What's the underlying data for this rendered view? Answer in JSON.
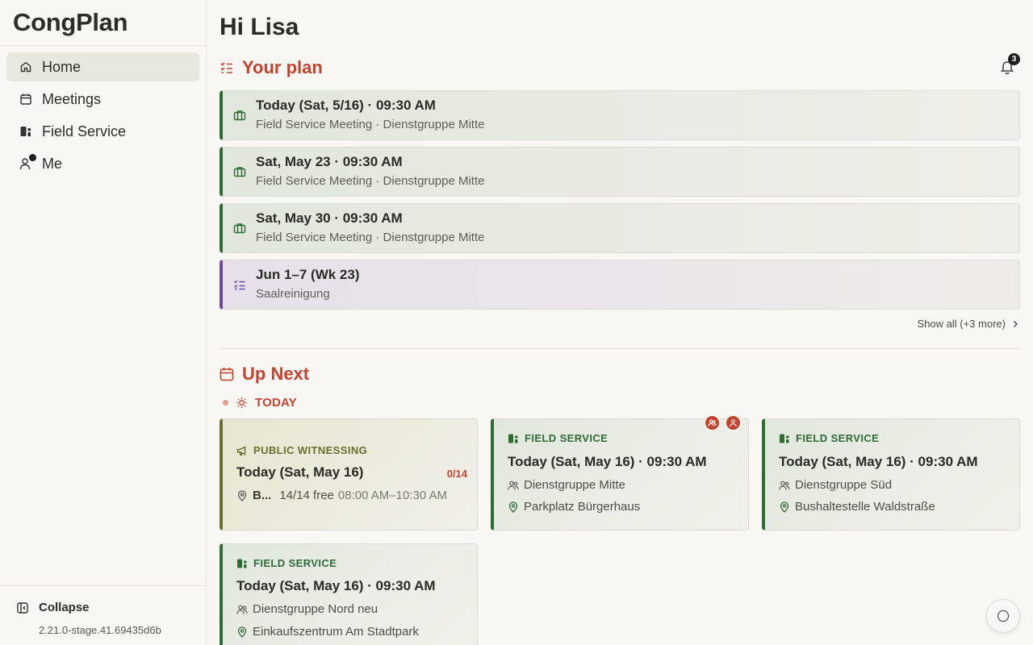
{
  "app": {
    "name": "CongPlan",
    "version": "2.21.0-stage.41.69435d6b"
  },
  "sidebar": {
    "items": [
      {
        "label": "Home",
        "icon": "home-icon",
        "active": true
      },
      {
        "label": "Meetings",
        "icon": "calendar-icon"
      },
      {
        "label": "Field Service",
        "icon": "field-service-icon"
      },
      {
        "label": "Me",
        "icon": "user-icon",
        "has_dot": true
      }
    ],
    "collapse_label": "Collapse"
  },
  "greeting": "Hi Lisa",
  "notifications": {
    "count": "3"
  },
  "plan": {
    "title": "Your plan",
    "items": [
      {
        "title": "Today (Sat, 5/16) · 09:30 AM",
        "subtitle": "Field Service Meeting · Dienstgruppe Mitte",
        "icon": "briefcase-icon",
        "color": "#2e6b35"
      },
      {
        "title": "Sat, May 23 · 09:30 AM",
        "subtitle": "Field Service Meeting · Dienstgruppe Mitte",
        "icon": "briefcase-icon",
        "color": "#2e6b35"
      },
      {
        "title": "Sat, May 30 · 09:30 AM",
        "subtitle": "Field Service Meeting · Dienstgruppe Mitte",
        "icon": "briefcase-icon",
        "color": "#2e6b35"
      },
      {
        "title": "Jun 1–7 (Wk 23)",
        "subtitle": "Saalreinigung",
        "icon": "checklist-icon",
        "color": "#6d4a9c"
      }
    ],
    "show_all": "Show all (+3 more)"
  },
  "up_next": {
    "title": "Up Next",
    "today_label": "TODAY",
    "cards": [
      {
        "kind": "PUBLIC WITNESSING",
        "title": "Today (Sat, May 16)",
        "count": "0/14",
        "location_short": "B...",
        "free": "14/14 free",
        "time": "08:00 AM–10:30 AM"
      },
      {
        "kind": "FIELD SERVICE",
        "title": "Today (Sat, May 16) · 09:30 AM",
        "group": "Dienstgruppe Mitte",
        "location": "Parkplatz Bürgerhaus"
      },
      {
        "kind": "FIELD SERVICE",
        "title": "Today (Sat, May 16) · 09:30 AM",
        "group": "Dienstgruppe Süd",
        "location": "Bushaltestelle Waldstraße"
      },
      {
        "kind": "FIELD SERVICE",
        "title": "Today (Sat, May 16) · 09:30 AM",
        "group": "Dienstgruppe Nord neu",
        "location": "Einkaufszentrum Am Stadtpark"
      }
    ]
  },
  "colors": {
    "accent": "#c2432e",
    "field_service": "#2e6b35",
    "public_witnessing": "#6b6e2c",
    "cleaning": "#6d4a9c"
  }
}
